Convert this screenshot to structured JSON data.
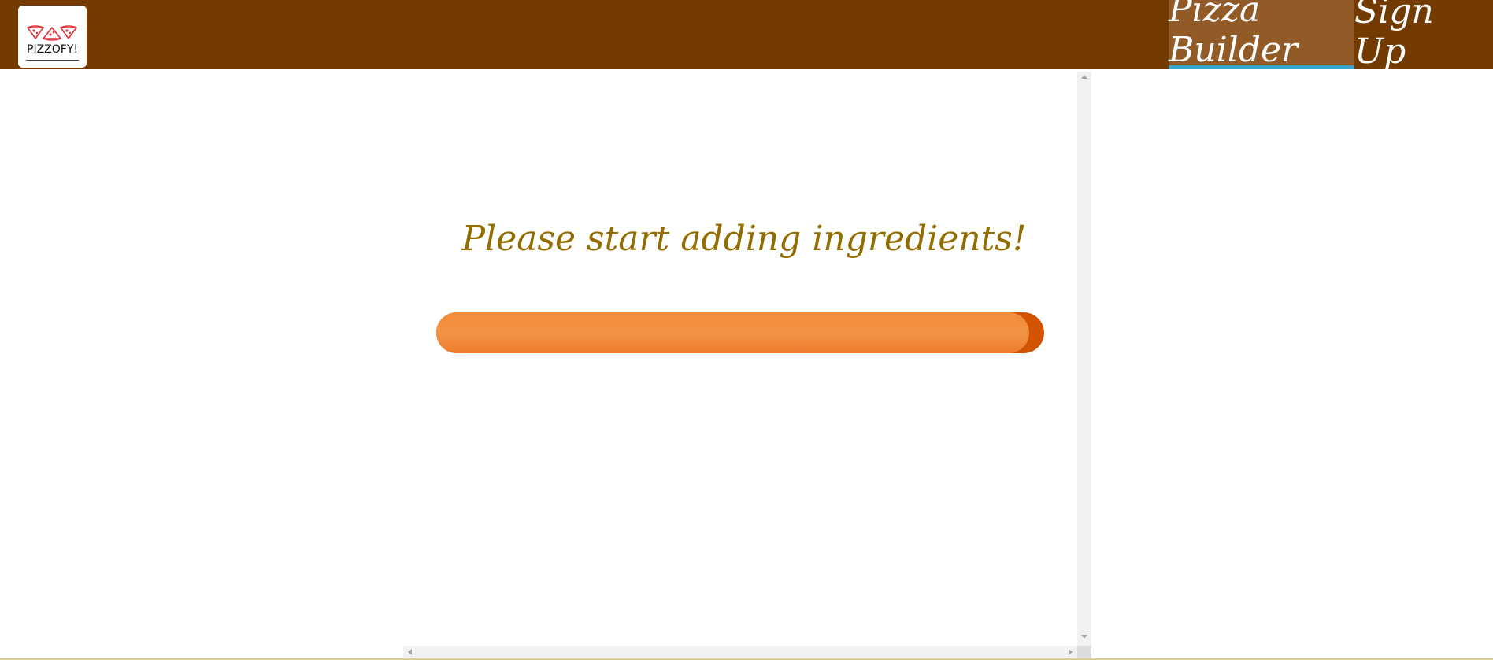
{
  "header": {
    "logo_text": "PIZZOFY!",
    "nav": [
      {
        "label": "Pizza Builder",
        "active": true
      },
      {
        "label": "Sign Up",
        "active": false
      }
    ]
  },
  "main": {
    "message": "Please start adding ingredients!"
  },
  "colors": {
    "header_bg": "#743b00",
    "active_nav_bg": "#925a26",
    "active_nav_underline": "#40a4c8",
    "message": "#946d00",
    "bun": "#f39244",
    "bun_shadow": "#d35400"
  }
}
